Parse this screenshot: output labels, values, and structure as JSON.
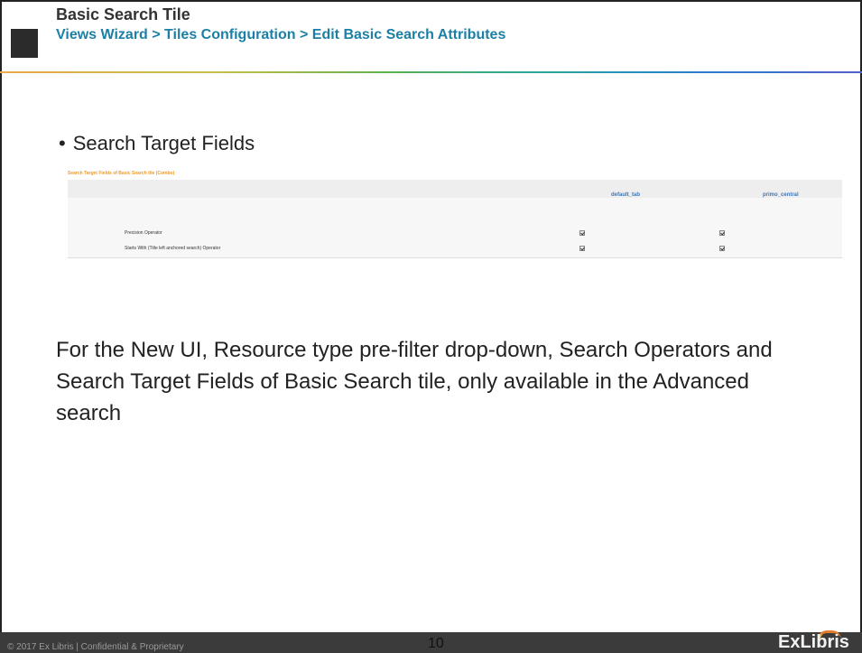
{
  "header": {
    "title": "Basic Search Tile",
    "breadcrumb": "Views Wizard > Tiles Configuration > Edit Basic Search Attributes"
  },
  "bullet": {
    "text": "Search Target Fields"
  },
  "embedded_screenshot": {
    "title": "Search Target Fields of Basic Search tile (Combo)",
    "columns": [
      "default_tab",
      "primo_central"
    ],
    "rows": [
      {
        "label": "Precision Operator",
        "checked": [
          true,
          true
        ]
      },
      {
        "label": "Starts With (Title left anchored search) Operator",
        "checked": [
          true,
          true
        ]
      }
    ]
  },
  "body": {
    "text": " For the New UI, Resource type pre-filter drop-down, Search Operators and Search Target Fields of Basic Search tile, only available in the Advanced search"
  },
  "footer": {
    "copyright": "© 2017 Ex Libris | Confidential & Proprietary",
    "page_number": "10",
    "logo_text": "ExLibris"
  },
  "colors": {
    "breadcrumb": "#1b7fa6",
    "embedded_title": "#f09a2a",
    "embedded_columns": "#3f78b8",
    "footer_bg": "#3b3b3b"
  }
}
